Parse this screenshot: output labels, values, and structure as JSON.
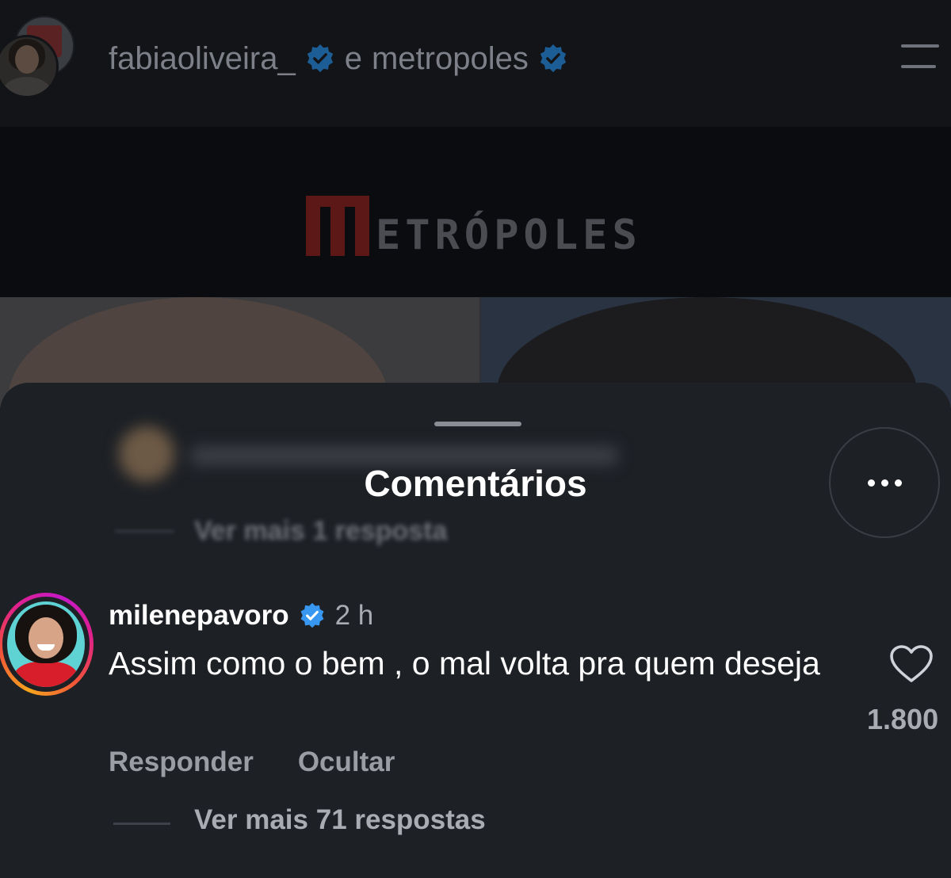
{
  "header": {
    "user1": "fabiaoliveira_",
    "conjunction": "e",
    "user2": "metropoles"
  },
  "banner": {
    "logo_text": "ETRÓPOLES"
  },
  "comments_sheet": {
    "title": "Comentários",
    "hidden_more_replies": "Ver mais 1 resposta",
    "comment": {
      "username": "milenepavoro",
      "time": "2 h",
      "text": "Assim como o bem , o mal volta pra quem deseja",
      "reply_label": "Responder",
      "hide_label": "Ocultar",
      "like_count": "1.800",
      "more_replies": "Ver mais 71 respostas"
    }
  },
  "icons": [
    "verified-badge-icon",
    "menu-icon",
    "more-options-icon",
    "heart-icon"
  ],
  "colors": {
    "verified": "#3897f0",
    "logo_red": "#5c1717",
    "sheet_bg": "#1d2025"
  }
}
